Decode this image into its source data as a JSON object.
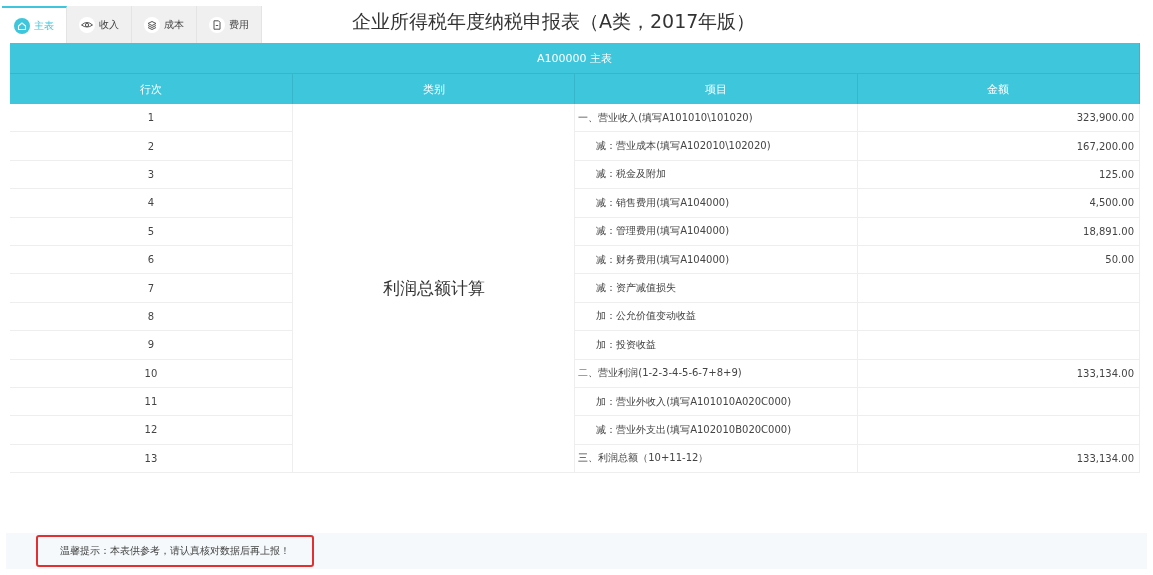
{
  "tabs": [
    {
      "label": "主表",
      "selected": true,
      "kind": "home"
    },
    {
      "label": "收入",
      "selected": false,
      "kind": "eye"
    },
    {
      "label": "成本",
      "selected": false,
      "kind": "layers"
    },
    {
      "label": "费用",
      "selected": false,
      "kind": "document"
    }
  ],
  "title": "企业所得税年度纳税申报表（A类，2017年版）",
  "table": {
    "caption": "A100000 主表",
    "columns": [
      "行次",
      "类别",
      "项目",
      "金额"
    ],
    "category": "利润总额计算",
    "rows": [
      {
        "line": "1",
        "item": "一、营业收入(填写A101010\\101020)",
        "indent": false,
        "amount": "323,900.00"
      },
      {
        "line": "2",
        "item": "减：营业成本(填写A102010\\102020)",
        "indent": true,
        "amount": "167,200.00"
      },
      {
        "line": "3",
        "item": "减：税金及附加",
        "indent": true,
        "amount": "125.00"
      },
      {
        "line": "4",
        "item": "减：销售费用(填写A104000)",
        "indent": true,
        "amount": "4,500.00"
      },
      {
        "line": "5",
        "item": "减：管理费用(填写A104000)",
        "indent": true,
        "amount": "18,891.00"
      },
      {
        "line": "6",
        "item": "减：财务费用(填写A104000)",
        "indent": true,
        "amount": "50.00"
      },
      {
        "line": "7",
        "item": "减：资产减值损失",
        "indent": true
      },
      {
        "line": "8",
        "item": "加：公允价值变动收益",
        "indent": true
      },
      {
        "line": "9",
        "item": "加：投资收益",
        "indent": true
      },
      {
        "line": "10",
        "item": "二、营业利润(1-2-3-4-5-6-7+8+9)",
        "indent": false,
        "amount": "133,134.00"
      },
      {
        "line": "11",
        "item": "加：营业外收入(填写A101010A020C000)",
        "indent": true
      },
      {
        "line": "12",
        "item": "减：营业外支出(填写A102010B020C000)",
        "indent": true
      },
      {
        "line": "13",
        "item": "三、利润总额（10+11-12）",
        "indent": false,
        "amount": "133,134.00"
      }
    ]
  },
  "notice": "温馨提示：本表供参考，请认真核对数据后再上报！"
}
